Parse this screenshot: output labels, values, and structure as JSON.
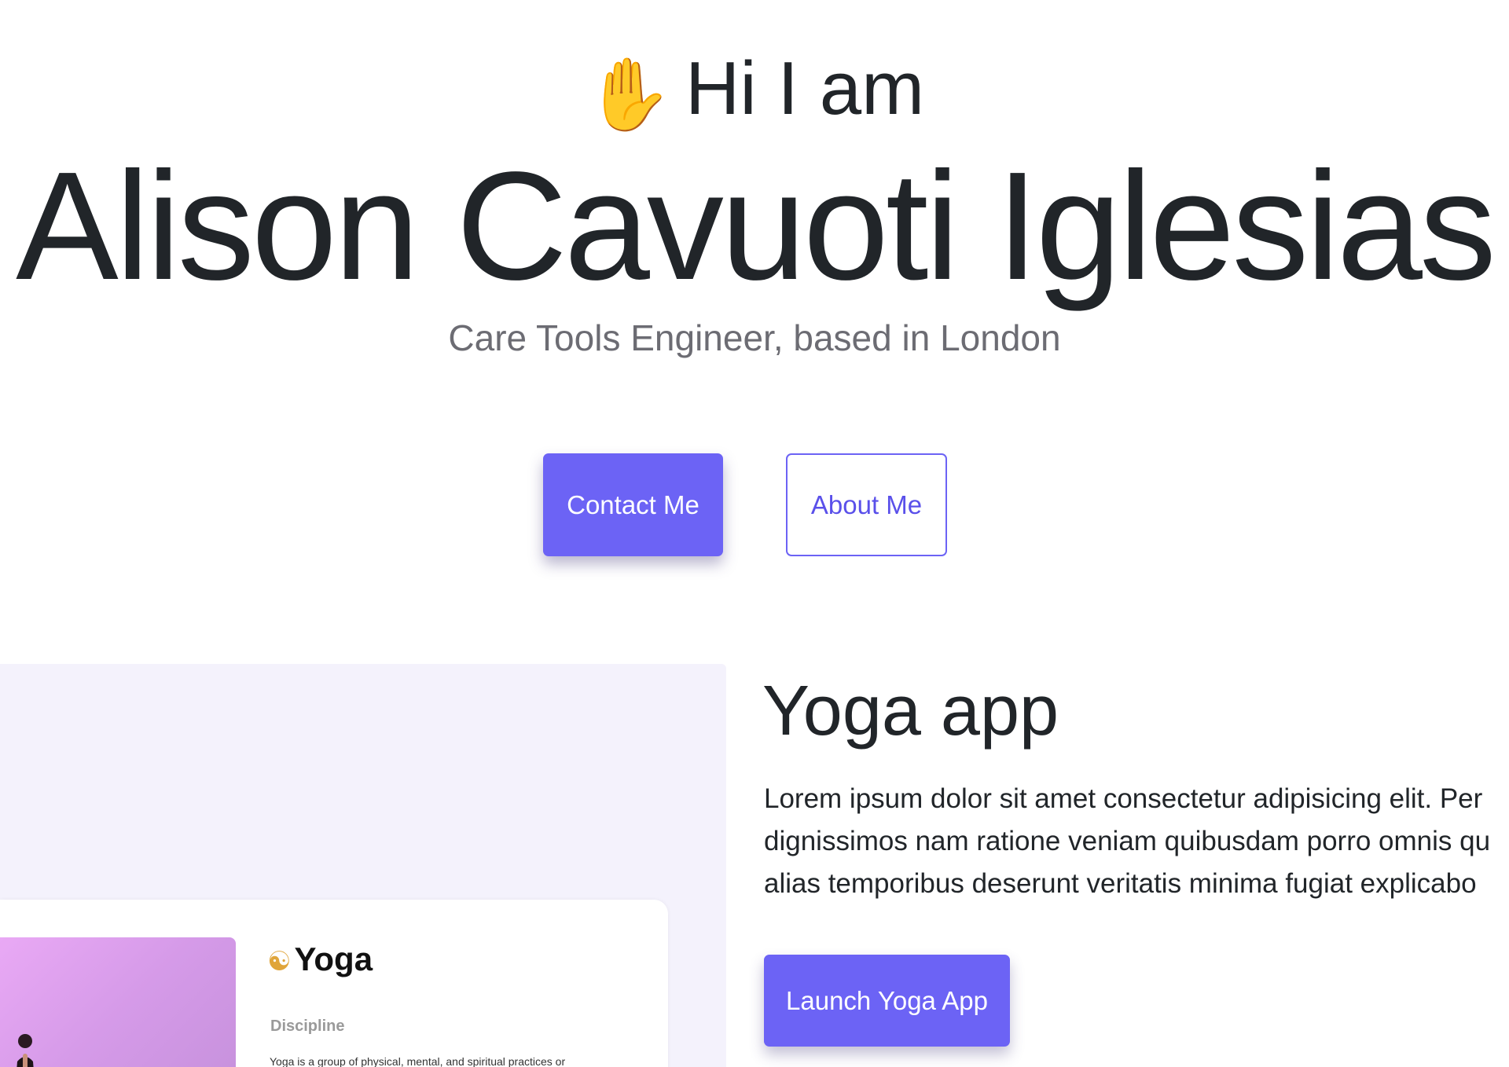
{
  "hero": {
    "greeting": "Hi I am",
    "greeting_icon": "waving-hand-icon",
    "name": "Alison Cavuoti Iglesias",
    "tagline": "Care Tools Engineer, based in London"
  },
  "actions": {
    "contact_label": "Contact Me",
    "about_label": "About Me"
  },
  "project": {
    "title": "Yoga app",
    "description_lines": [
      "Lorem ipsum dolor sit amet consectetur adipisicing elit. Per",
      "dignissimos nam ratione veniam quibusdam porro omnis qu",
      "alias temporibus deserunt veritatis minima fugiat explicabo"
    ],
    "launch_label": "Launch Yoga App",
    "preview": {
      "title": "Yoga",
      "title_icon": "meditation-icon",
      "subtitle": "Discipline",
      "body": "Yoga is a group of physical, mental, and spiritual practices or"
    }
  },
  "colors": {
    "accent": "#6c63f5",
    "text": "#212529",
    "muted": "#6c6c73",
    "panel": "#f4f2fc"
  }
}
